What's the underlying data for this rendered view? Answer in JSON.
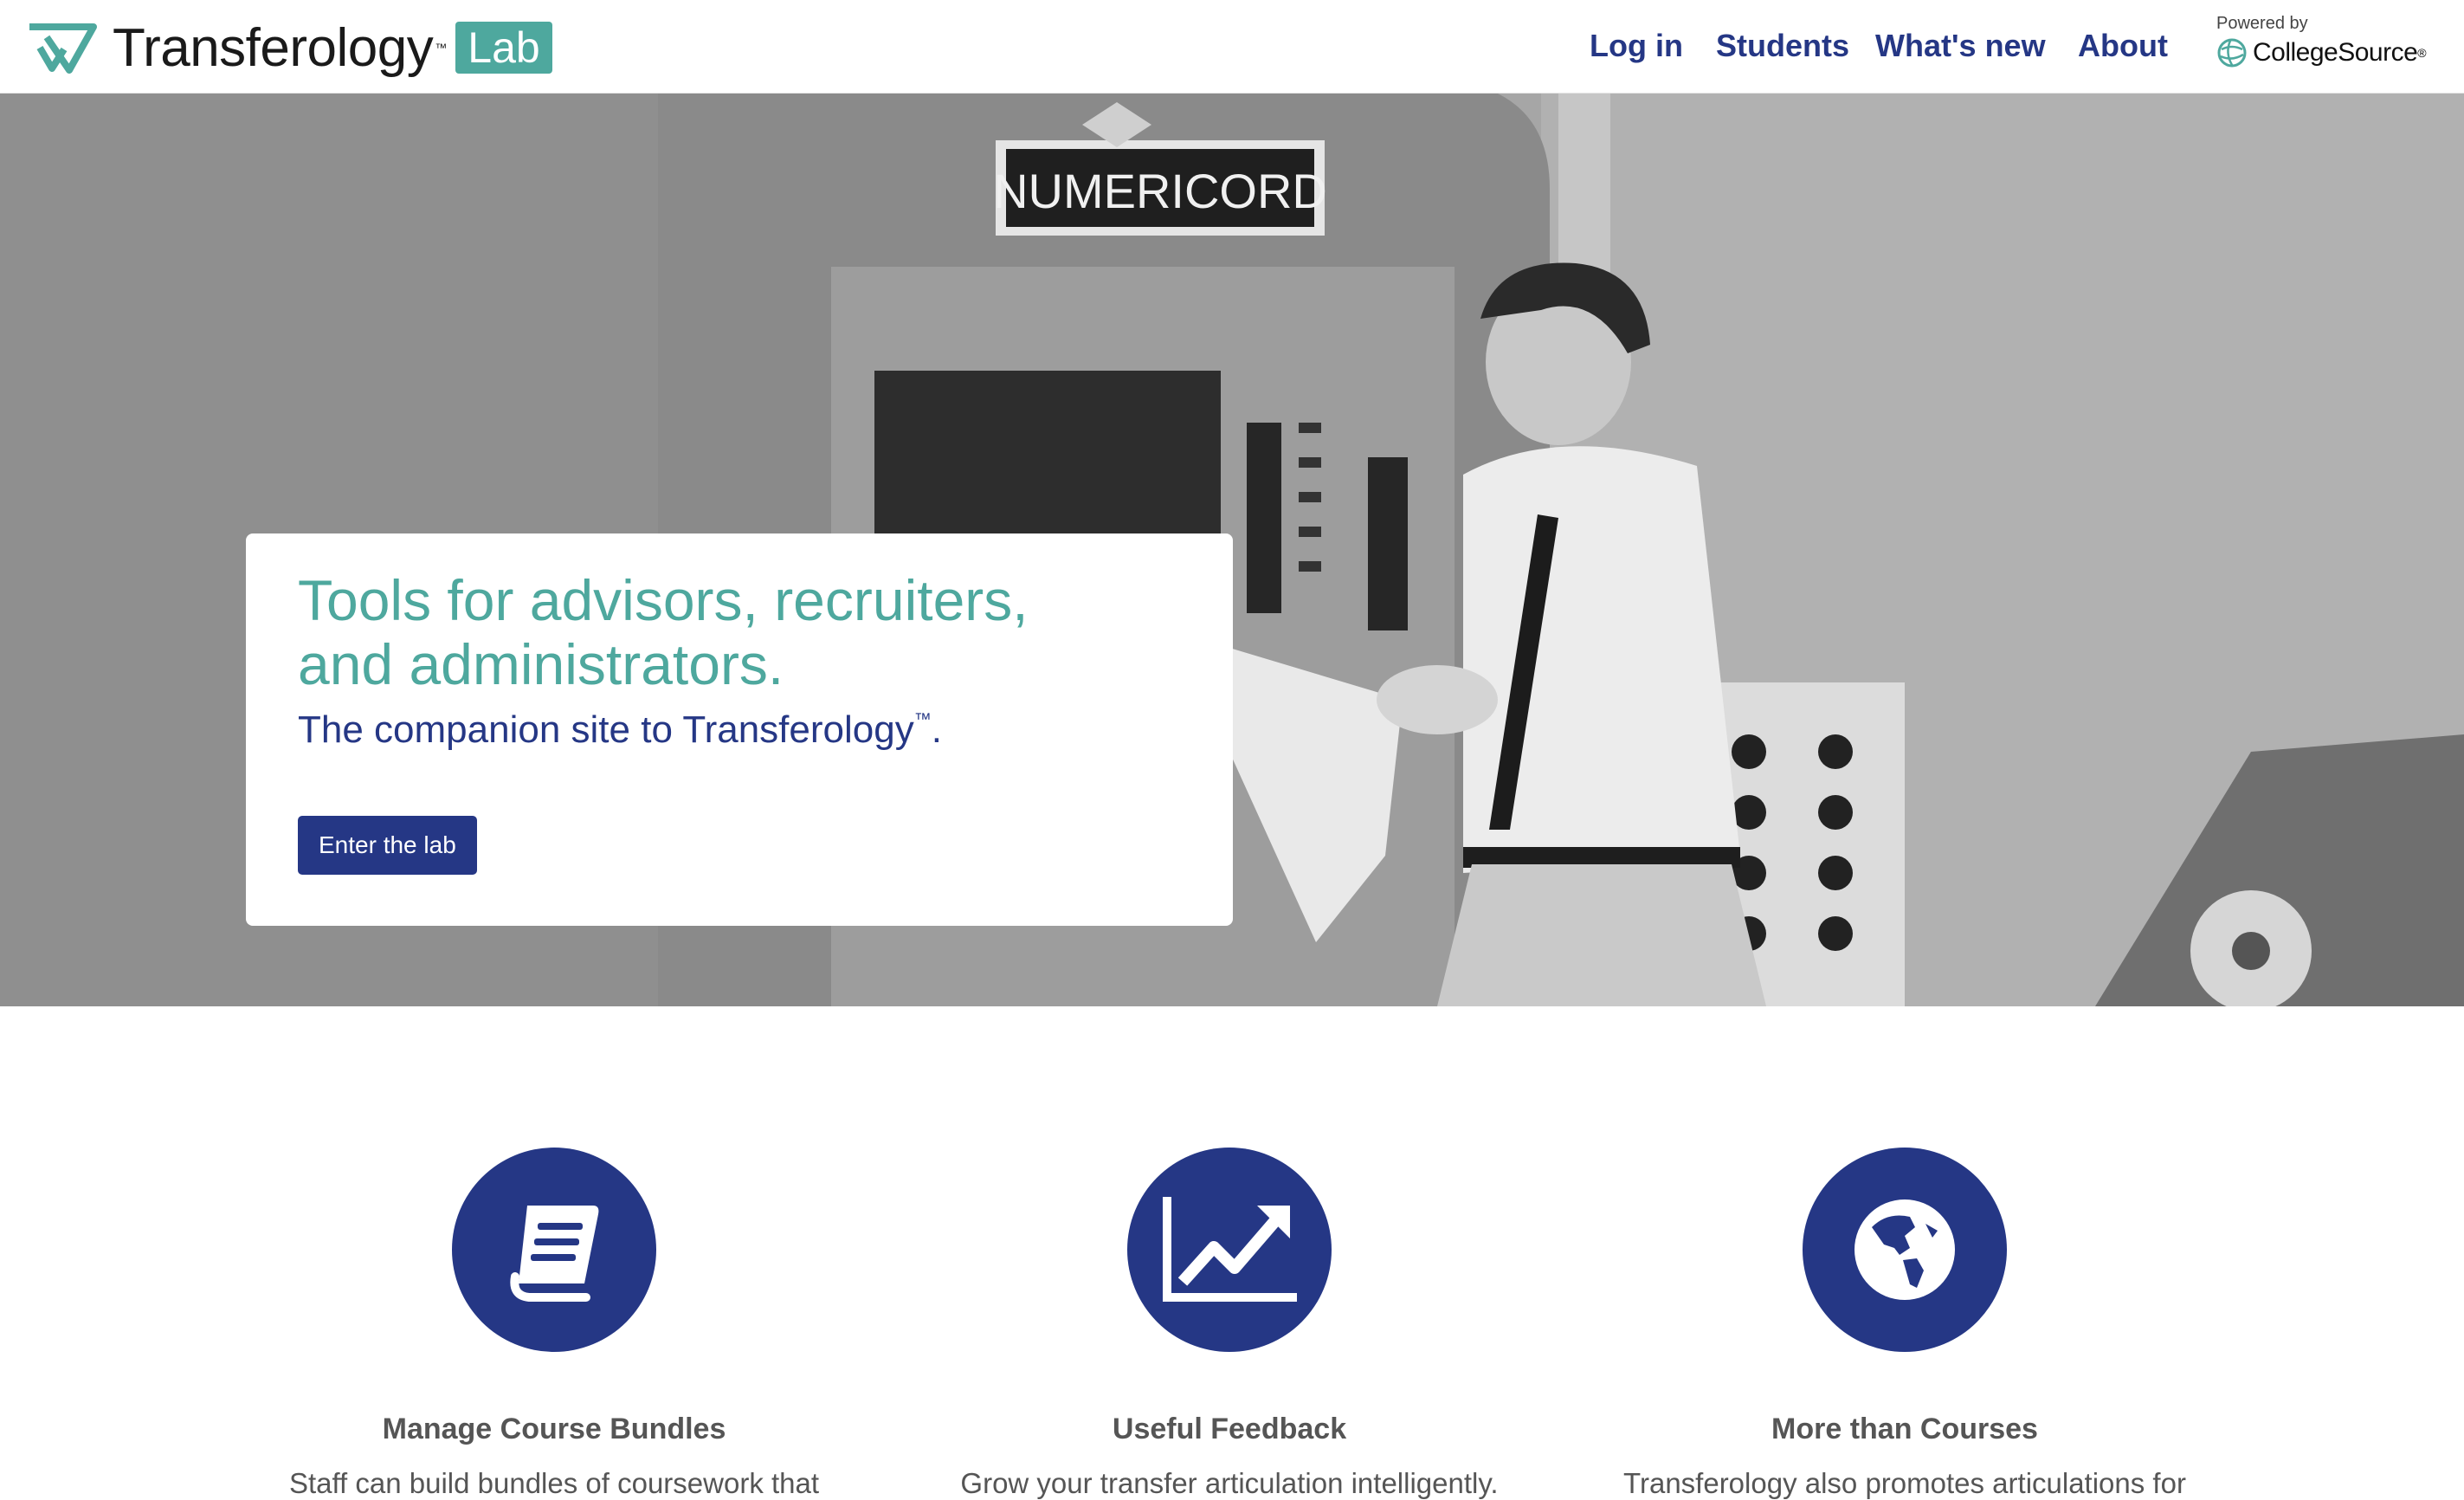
{
  "header": {
    "brand": "Transferology",
    "brand_tm": "™",
    "brand_lab": "Lab",
    "nav": [
      "Log in",
      "Students",
      "What's new",
      "About"
    ],
    "powered_by": "Powered by",
    "partner": "CollegeSource",
    "partner_reg": "®"
  },
  "hero": {
    "image_text": "NUMERICORD",
    "title": "Tools for advisors, recruiters, and administrators.",
    "subtitle_main": "The companion site to Transferology",
    "subtitle_tm": "™",
    "subtitle_end": ".",
    "cta_label": "Enter the lab"
  },
  "features": [
    {
      "icon": "book-icon",
      "title": "Manage Course Bundles",
      "description": "Staff can build bundles of coursework that"
    },
    {
      "icon": "chart-trend-icon",
      "title": "Useful Feedback",
      "description": "Grow your transfer articulation intelligently."
    },
    {
      "icon": "globe-icon",
      "title": "More than Courses",
      "description": "Transferology also promotes articulations for"
    }
  ],
  "colors": {
    "brand_navy": "#253785",
    "brand_teal": "#4ea89e",
    "text_gray": "#555555"
  }
}
